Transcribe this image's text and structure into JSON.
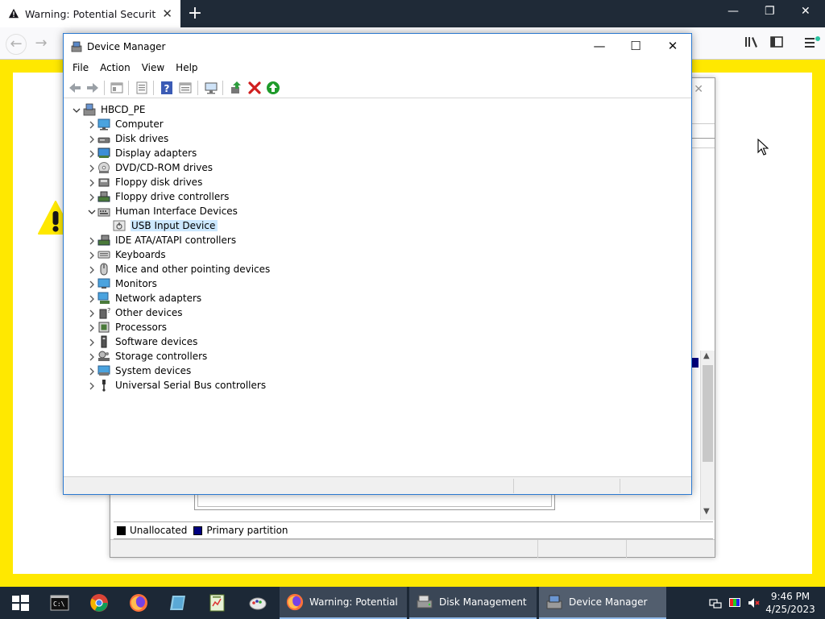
{
  "browser": {
    "tab_title": "Warning: Potential Security Risk Ahead",
    "new_tab_label": "+",
    "close_tab_glyph": "✕",
    "minimize_glyph": "—",
    "restore_glyph": "❐",
    "close_glyph": "✕",
    "back_glyph": "←",
    "forward_glyph": "→"
  },
  "device_manager": {
    "title": "Device Manager",
    "menu": [
      "File",
      "Action",
      "View",
      "Help"
    ],
    "controls": {
      "minimize": "—",
      "maximize": "☐",
      "close": "✕"
    },
    "root": "HBCD_PE",
    "categories": [
      {
        "label": "Computer",
        "icon": "computer-icon"
      },
      {
        "label": "Disk drives",
        "icon": "disk-drive-icon"
      },
      {
        "label": "Display adapters",
        "icon": "display-adapter-icon"
      },
      {
        "label": "DVD/CD-ROM drives",
        "icon": "dvd-icon"
      },
      {
        "label": "Floppy disk drives",
        "icon": "floppy-icon"
      },
      {
        "label": "Floppy drive controllers",
        "icon": "floppy-controller-icon"
      },
      {
        "label": "Human Interface Devices",
        "icon": "hid-icon",
        "expanded": true,
        "children": [
          {
            "label": "USB Input Device",
            "icon": "usb-input-icon",
            "selected": true
          }
        ]
      },
      {
        "label": "IDE ATA/ATAPI controllers",
        "icon": "ide-controller-icon"
      },
      {
        "label": "Keyboards",
        "icon": "keyboard-icon"
      },
      {
        "label": "Mice and other pointing devices",
        "icon": "mouse-icon"
      },
      {
        "label": "Monitors",
        "icon": "monitor-icon"
      },
      {
        "label": "Network adapters",
        "icon": "network-adapter-icon"
      },
      {
        "label": "Other devices",
        "icon": "other-devices-icon"
      },
      {
        "label": "Processors",
        "icon": "processor-icon"
      },
      {
        "label": "Software devices",
        "icon": "software-device-icon"
      },
      {
        "label": "Storage controllers",
        "icon": "storage-controller-icon"
      },
      {
        "label": "System devices",
        "icon": "system-device-icon"
      },
      {
        "label": "Universal Serial Bus controllers",
        "icon": "usb-controller-icon"
      }
    ]
  },
  "disk_management": {
    "legend": [
      {
        "label": "Unallocated",
        "color": "#000000"
      },
      {
        "label": "Primary partition",
        "color": "#000080"
      }
    ]
  },
  "taskbar": {
    "buttons": [
      {
        "label": "Warning: Potential Security Risk Ahead — Mozilla Firefox",
        "icon": "firefox-icon"
      },
      {
        "label": "Disk Management",
        "icon": "disk-management-icon"
      },
      {
        "label": "Device Manager",
        "icon": "device-manager-icon"
      }
    ],
    "time": "9:46 PM",
    "date": "4/25/2023"
  },
  "colors": {
    "warning_yellow": "#ffe800",
    "titlebar_blue": "#2b79d0",
    "selection": "#cce8ff",
    "taskbar": "#1c2836"
  }
}
